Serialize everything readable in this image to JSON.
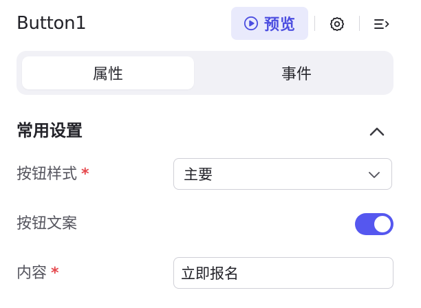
{
  "header": {
    "title": "Button1",
    "preview_label": "预览",
    "preview_icon": "play-circle-icon",
    "settings_icon": "gear-icon",
    "collapse_panel_icon": "collapse-panel-icon",
    "accent_color": "#4c4ee0"
  },
  "tabs": [
    {
      "label": "属性",
      "active": true
    },
    {
      "label": "事件",
      "active": false
    }
  ],
  "section": {
    "title": "常用设置",
    "toggle_icon": "chevron-up-icon",
    "expanded": true
  },
  "fields": {
    "button_style": {
      "label": "按钮样式",
      "required_mark": "*",
      "value": "主要",
      "icon": "chevron-down-icon"
    },
    "button_text": {
      "label": "按钮文案",
      "enabled": true
    },
    "content": {
      "label": "内容",
      "required_mark": "*",
      "value": "立即报名"
    }
  },
  "colors": {
    "toggle_on": "#5557ef",
    "required": "#e5484d",
    "preview_bg": "#e9eafc"
  }
}
